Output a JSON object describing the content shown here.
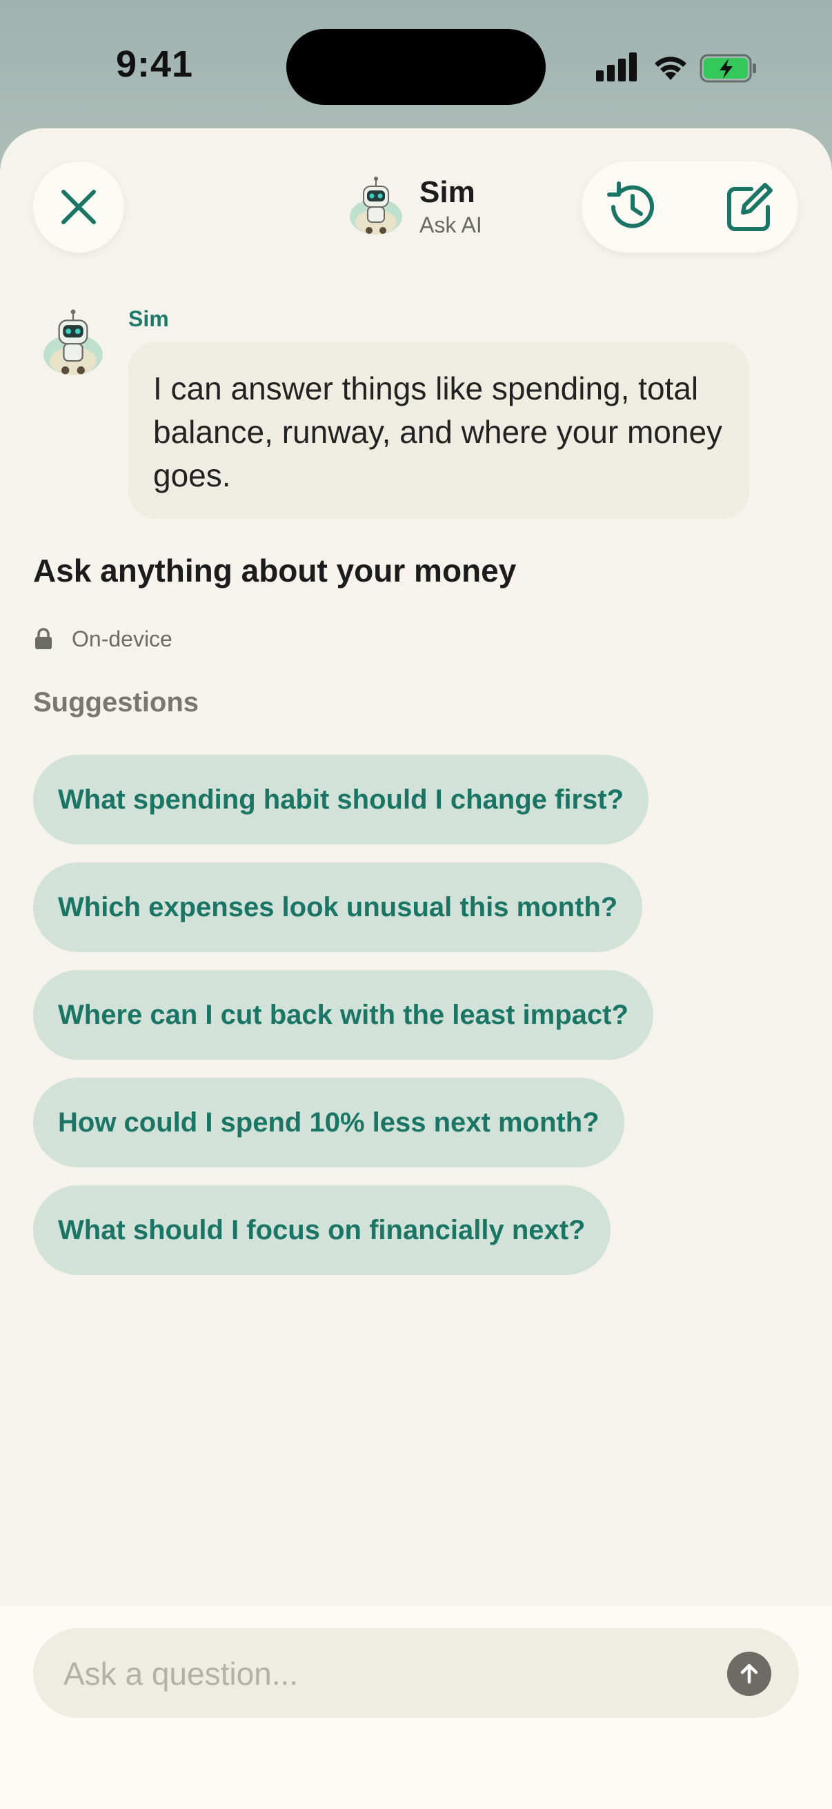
{
  "status_bar": {
    "time": "9:41"
  },
  "header": {
    "title": "Sim",
    "subtitle": "Ask AI",
    "close_icon": "close-icon",
    "history_icon": "history-icon",
    "compose_icon": "compose-icon"
  },
  "message": {
    "sender": "Sim",
    "text": "I can answer things like spending, total balance, runway, and where your money goes."
  },
  "intro": {
    "title": "Ask anything about your money",
    "privacy_label": "On-device",
    "suggestions_title": "Suggestions"
  },
  "suggestions": [
    "What spending habit should I change first?",
    "Which expenses look unusual this month?",
    "Where can I cut back with the least impact?",
    "How could I spend 10% less next month?",
    "What should I focus on financially next?"
  ],
  "composer": {
    "placeholder": "Ask a question...",
    "value": ""
  },
  "colors": {
    "accent": "#1d7a69",
    "chip_bg": "#d2e2d9",
    "bubble_bg": "#efece2",
    "sheet_bg": "#f6f3ec"
  }
}
